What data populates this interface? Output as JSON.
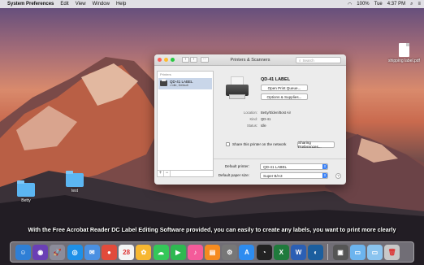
{
  "menubar": {
    "apple": "",
    "app_name": "System Preferences",
    "items": [
      "Edit",
      "View",
      "Window",
      "Help"
    ],
    "status": {
      "battery": "100%",
      "day": "Tue",
      "time": "4:37 PM"
    }
  },
  "desktop": {
    "icons": [
      {
        "label": "Betty",
        "kind": "folder"
      },
      {
        "label": "test",
        "kind": "folder"
      },
      {
        "label": "shipping label.pdf",
        "kind": "pdf"
      }
    ]
  },
  "window": {
    "title": "Printers & Scanners",
    "search_placeholder": "Search",
    "printers_header": "Printers",
    "printer_list": [
      {
        "name": "QD-41 LABEL",
        "status": "• Idle, Default"
      }
    ],
    "add_label": "+",
    "remove_label": "−",
    "selected": {
      "name": "QD-41 LABEL",
      "open_queue": "Open Print Queue...",
      "options": "Options & Supplies...",
      "info": [
        {
          "label": "Location:",
          "value": "Betty/Elden/Bost Air"
        },
        {
          "label": "Kind:",
          "value": "QD-41"
        },
        {
          "label": "Status:",
          "value": "Idle"
        }
      ],
      "share_label": "Share this printer on the network",
      "share_prefs": "Sharing Preferences..."
    },
    "default_printer_label": "Default printer:",
    "default_printer_value": "QD-41 LABEL",
    "default_paper_label": "Default paper size:",
    "default_paper_value": "Super B/A3",
    "help": "?"
  },
  "caption": "With the Free Acrobat Reader DC Label Editing Software provided, you can easily to create any labels, you want to print more clearly",
  "dock": [
    {
      "name": "finder-icon",
      "glyph": "☺",
      "color": "#2f7fd6"
    },
    {
      "name": "siri-icon",
      "glyph": "◉",
      "color": "#6a3fb5"
    },
    {
      "name": "launchpad-icon",
      "glyph": "🚀",
      "color": "#8c8c9a"
    },
    {
      "name": "safari-icon",
      "glyph": "◎",
      "color": "#1e90e8"
    },
    {
      "name": "mail-icon",
      "glyph": "✉",
      "color": "#4a90e2"
    },
    {
      "name": "chrome-icon",
      "glyph": "●",
      "color": "#e14b3b"
    },
    {
      "name": "calendar-icon",
      "glyph": "28",
      "color": "#f4f4f4"
    },
    {
      "name": "photos-icon",
      "glyph": "✿",
      "color": "#f7b731"
    },
    {
      "name": "messages-icon",
      "glyph": "☁",
      "color": "#34c759"
    },
    {
      "name": "facetime-icon",
      "glyph": "▶",
      "color": "#2eb851"
    },
    {
      "name": "itunes-icon",
      "glyph": "♪",
      "color": "#f45b9a"
    },
    {
      "name": "ibooks-icon",
      "glyph": "▤",
      "color": "#f58b1f"
    },
    {
      "name": "system-preferences-icon",
      "glyph": "⚙",
      "color": "#777"
    },
    {
      "name": "app-store-icon",
      "glyph": "A",
      "color": "#2d8cf0"
    },
    {
      "name": "qq-icon",
      "glyph": "◔",
      "color": "#222"
    },
    {
      "name": "excel-icon",
      "glyph": "X",
      "color": "#1f7a3c"
    },
    {
      "name": "word-icon",
      "glyph": "W",
      "color": "#2b5fb4"
    },
    {
      "name": "screen-recorder-icon",
      "glyph": "◐",
      "color": "#1b5e9e"
    },
    {
      "name": "printer-app-icon",
      "glyph": "▣",
      "color": "#555"
    },
    {
      "name": "documents-folder-icon",
      "glyph": "▭",
      "color": "#6cb4ee"
    },
    {
      "name": "downloads-folder-icon",
      "glyph": "▭",
      "color": "#8bc4ef"
    },
    {
      "name": "trash-icon",
      "glyph": "🗑",
      "color": "#c8c8c8"
    }
  ]
}
